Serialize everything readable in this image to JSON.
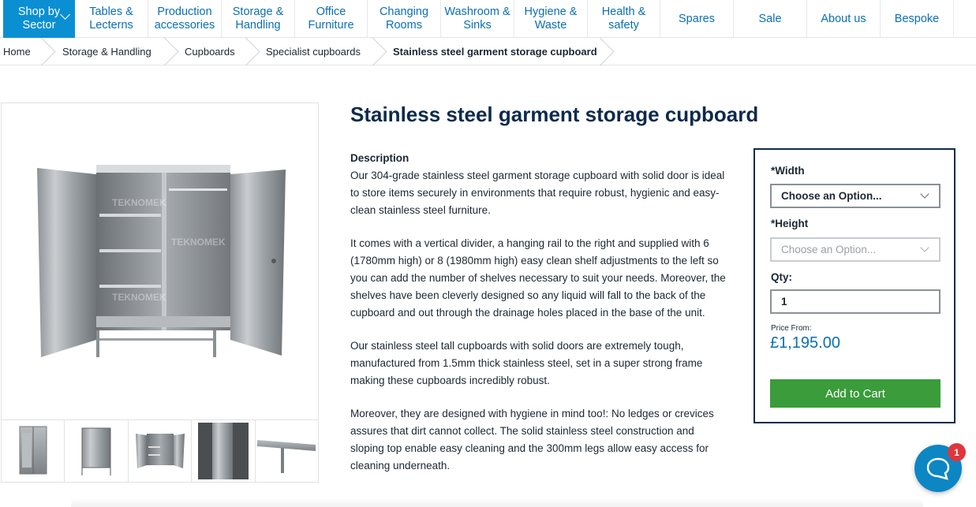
{
  "nav": {
    "items": [
      {
        "label": "Shop by\nSector"
      },
      {
        "label": "Tables &\nLecterns"
      },
      {
        "label": "Production\naccessories"
      },
      {
        "label": "Storage &\nHandling"
      },
      {
        "label": "Office\nFurniture"
      },
      {
        "label": "Changing\nRooms"
      },
      {
        "label": "Washroom &\nSinks"
      },
      {
        "label": "Hygiene &\nWaste"
      },
      {
        "label": "Health &\nsafety"
      },
      {
        "label": "Spares"
      },
      {
        "label": "Sale"
      },
      {
        "label": "About us"
      },
      {
        "label": "Bespoke"
      }
    ]
  },
  "breadcrumb": [
    "Home",
    "Storage & Handling",
    "Cupboards",
    "Specialist cupboards",
    "Stainless steel garment storage cupboard"
  ],
  "product": {
    "title": "Stainless steel garment storage cupboard",
    "description_heading": "Description",
    "paragraphs": [
      "Our 304-grade stainless steel garment storage cupboard with solid door is ideal to store items securely in environments that require robust, hygienic and easy-clean stainless steel furniture.",
      "It comes with a vertical divider, a hanging rail to the right and supplied with 6 (1780mm high) or 8 (1980mm high) easy clean shelf adjustments to the left so you can add the number of shelves necessary to suit your needs. Moreover, the shelves have been cleverly designed so any liquid will fall to the back of the cupboard and out through the drainage holes placed in the base of the unit.",
      "Our stainless steel tall cupboards with solid doors are extremely tough, manufactured from 1.5mm thick stainless steel, set in a super strong frame making these cupboards incredibly robust.",
      "Moreover, they are designed with hygiene in mind too!: No ledges or crevices assures that dirt cannot collect. The solid stainless steel construction and sloping top enable easy cleaning and the 300mm legs allow easy access for cleaning underneath."
    ],
    "watermark": "TEKNOMEK"
  },
  "options": {
    "width_label": "*Width",
    "width_value": "Choose an Option...",
    "height_label": "*Height",
    "height_value": "Choose an Option...",
    "qty_label": "Qty:",
    "qty_value": "1",
    "price_label": "Price From:",
    "price": "£1,195.00",
    "add_to_cart": "Add to Cart"
  },
  "chat": {
    "badge": "1"
  },
  "colors": {
    "accent": "#0b8fd3",
    "link": "#0a6fb5",
    "title": "#0d2a4c",
    "cart": "#3a9c3a",
    "badge": "#e0353c"
  }
}
